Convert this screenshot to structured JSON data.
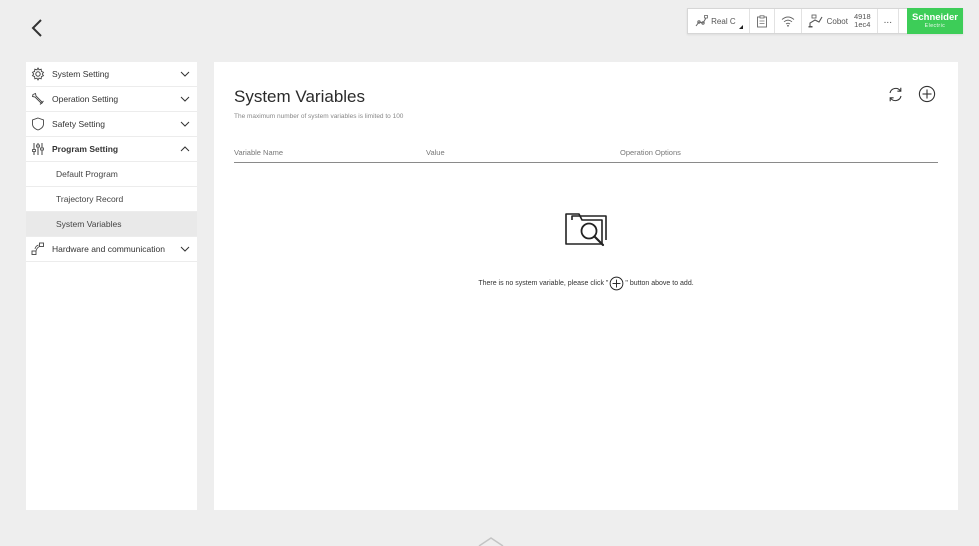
{
  "topbar": {
    "mode_label": "Real C",
    "robot_label": "Cobot",
    "serial_top": "4918",
    "serial_bottom": "1ec4",
    "more_label": "...",
    "brand_name": "Schneider",
    "brand_sub": "Electric",
    "brand_color": "#3dcd58"
  },
  "sidebar": {
    "items": [
      {
        "label": "System Setting",
        "icon": "gear-icon"
      },
      {
        "label": "Operation Setting",
        "icon": "wrench-icon"
      },
      {
        "label": "Safety Setting",
        "icon": "shield-icon"
      },
      {
        "label": "Program Setting",
        "icon": "sliders-icon"
      },
      {
        "label": "Hardware and communication",
        "icon": "network-icon"
      }
    ],
    "subitems": [
      {
        "label": "Default Program"
      },
      {
        "label": "Trajectory Record"
      },
      {
        "label": "System Variables"
      }
    ]
  },
  "main": {
    "title": "System Variables",
    "subtitle": "The maximum number of system variables is limited to 100",
    "columns": [
      "Variable Name",
      "Value",
      "Operation Options"
    ],
    "empty_before": "There is no system variable, please click \"",
    "empty_after": "\" button above to add."
  }
}
